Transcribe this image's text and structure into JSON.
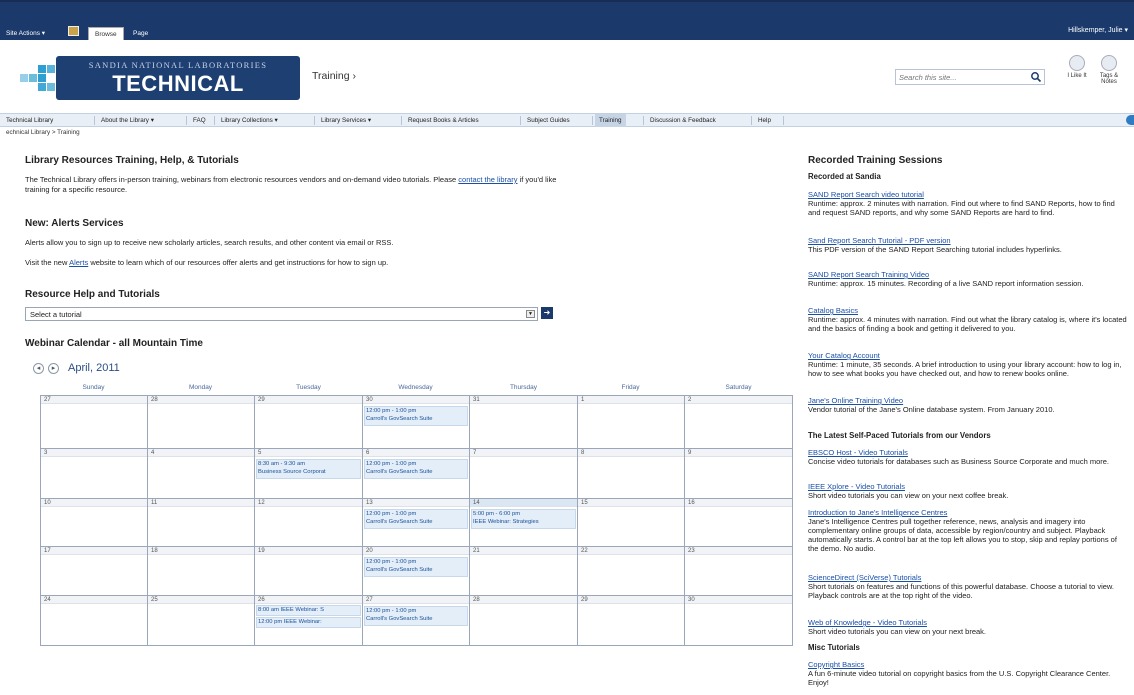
{
  "ribbon": {
    "site_actions": "Site Actions ▾",
    "tabs": [
      "Browse",
      "Page"
    ],
    "user": "Hillskemper, Julie ▾"
  },
  "header": {
    "logo_sub": "SANDIA NATIONAL LABORATORIES",
    "logo_main": "TECHNICAL LIBRARY",
    "page_title": "Training ›",
    "search_placeholder": "Search this site...",
    "like_label": "I Like It",
    "tags_label": "Tags & Notes"
  },
  "topnav": [
    "Technical Library",
    "About the Library ▾",
    "FAQ",
    "Library Collections ▾",
    "Library Services ▾",
    "Request Books & Articles",
    "Subject Guides",
    "Training",
    "Discussion & Feedback",
    "Help"
  ],
  "breadcrumb": "echnical Library > Training",
  "main": {
    "h1": "Library Resources Training, Help, & Tutorials",
    "intro_a": "The Technical Library offers in-person training, webinars from electronic resources vendors and on-demand video tutorials.  Please ",
    "intro_link": "contact the library",
    "intro_b": " if you'd like",
    "intro_c": "training for a specific resource.",
    "h2": "New: Alerts Services",
    "alerts_p1": "Alerts allow you to sign up to receive new scholarly articles, search results, and other content via email or RSS.",
    "alerts_p2a": "Visit the new ",
    "alerts_link": "Alerts",
    "alerts_p2b": " website to learn which of our resources offer alerts and get instructions for how to sign up.",
    "h3": "Resource Help and Tutorials",
    "select_value": "Select a tutorial",
    "h4": "Webinar Calendar - all Mountain Time",
    "month": "April, 2011"
  },
  "calendar": {
    "days": [
      "Sunday",
      "Monday",
      "Tuesday",
      "Wednesday",
      "Thursday",
      "Friday",
      "Saturday"
    ],
    "weeks": [
      [
        "27",
        "28",
        "29",
        "30",
        "31",
        "1",
        "2"
      ],
      [
        "3",
        "4",
        "5",
        "6",
        "7",
        "8",
        "9"
      ],
      [
        "10",
        "11",
        "12",
        "13",
        "14",
        "15",
        "16"
      ],
      [
        "17",
        "18",
        "19",
        "20",
        "21",
        "22",
        "23"
      ],
      [
        "24",
        "25",
        "26",
        "27",
        "28",
        "29",
        "30"
      ]
    ],
    "events": {
      "w0d3": [
        "12:00 pm - 1:00 pm",
        "Carroll's GovSearch Suite"
      ],
      "w1d2": [
        "8:30 am - 9:30 am",
        "Business Source Corporat"
      ],
      "w1d3": [
        "12:00 pm - 1:00 pm",
        "Carroll's GovSearch Suite"
      ],
      "w2d3": [
        "12:00 pm - 1:00 pm",
        "Carroll's GovSearch Suite"
      ],
      "w2d4": [
        "5:00 pm - 6:00 pm",
        "IEEE Webinar: Strategies"
      ],
      "w3d3": [
        "12:00 pm - 1:00 pm",
        "Carroll's GovSearch Suite"
      ],
      "w4d2a": "8:00 am IEEE Webinar: S",
      "w4d2b": "12:00 pm IEEE Webinar:",
      "w4d3": [
        "12:00 pm - 1:00 pm",
        "Carroll's GovSearch Suite"
      ]
    }
  },
  "right": {
    "title": "Recorded Training Sessions",
    "sub1": "Recorded at Sandia",
    "items1": [
      {
        "link": "SAND Report Search video tutorial",
        "text": "Runtime: approx. 2 minutes with narration. Find out where to find SAND Reports, how to find and request SAND reports, and why some SAND Reports are hard to find."
      },
      {
        "link": "Sand Report Search Tutorial - PDF version",
        "text": "This PDF version of the SAND Report Searching tutorial includes hyperlinks."
      },
      {
        "link": "SAND Report Search Training Video",
        "text": "Runtime: approx. 15 minutes. Recording of a live SAND report information session."
      },
      {
        "link": "Catalog Basics",
        "text": "Runtime: approx. 4 minutes with narration. Find out what the library catalog is, where it's located and the basics of finding a book and getting it delivered to you."
      },
      {
        "link": "Your Catalog Account",
        "text": "Runtime: 1 minute, 35 seconds. A brief introduction to using your library account: how to log in, how to see what books you have checked out, and how to renew books online."
      },
      {
        "link": "Jane's Online Training Video",
        "text": "Vendor tutorial of the Jane's Online database system. From January 2010."
      }
    ],
    "sub2": "The Latest Self-Paced Tutorials from our Vendors",
    "items2": [
      {
        "link": "EBSCO Host - Video Tutorials",
        "text": "Concise video tutorials for databases such as Business Source Corporate and much more."
      },
      {
        "link": "IEEE Xplore - Video Tutorials",
        "text": "Short video tutorials you can view on your next coffee break."
      },
      {
        "link": "Introduction to Jane's Intelligence Centres",
        "text": "Jane's Intelligence Centres pull together reference, news, analysis and imagery into complementary online groups of data, accessible by region/country and subject. Playback automatically starts. A control bar at the top left allows you to stop, skip and replay portions of the demo. No audio."
      },
      {
        "link": "ScienceDirect (SciVerse) Tutorials",
        "text": "Short tutorials on features and functions of this powerful database. Choose a tutorial to view. Playback controls are at the top right of the video."
      },
      {
        "link": "Web of Knowledge - Video Tutorials",
        "text": "Short video tutorials you can view on your next break."
      }
    ],
    "sub3": "Misc Tutorials",
    "items3": [
      {
        "link": "Copyright Basics",
        "text": "A fun 6-minute video tutorial on copyright basics from the U.S. Copyright Clearance Center. Enjoy!"
      }
    ]
  },
  "colors": {
    "ribbon": "#1b3a6b",
    "link": "#1a4fa8",
    "event_bg": "#e3eef8"
  }
}
